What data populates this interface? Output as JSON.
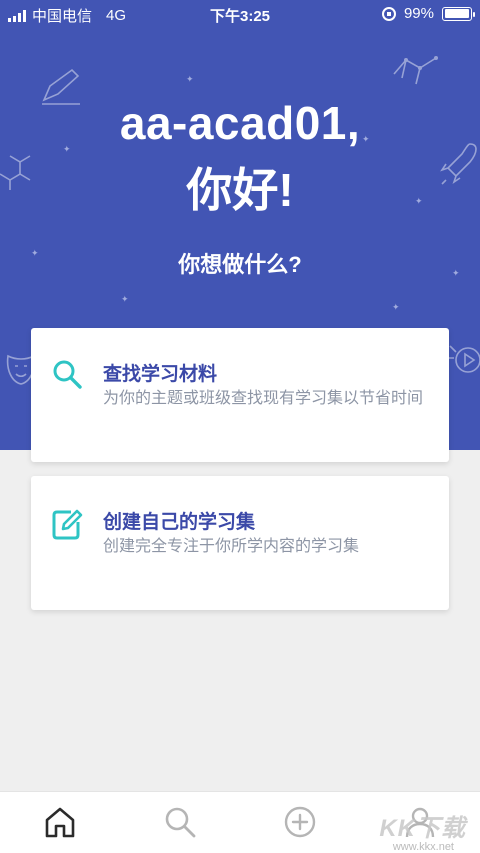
{
  "status_bar": {
    "carrier": "中国电信",
    "network": "4G",
    "time": "下午3:25",
    "battery_percent": "99%",
    "battery_level": 0.99
  },
  "greeting": {
    "username_line": "aa-acad01,",
    "hello_line": "你好!",
    "question": "你想做什么?"
  },
  "cards": {
    "find": {
      "title": "查找学习材料",
      "description": "为你的主题或班级查找现有学习集以节省时间",
      "icon": "search-icon"
    },
    "create": {
      "title": "创建自己的学习集",
      "description": "创建完全专注于你所学内容的学习集",
      "icon": "edit-icon"
    }
  },
  "tabbar": {
    "items": [
      {
        "name": "home",
        "icon": "home-icon",
        "active": true
      },
      {
        "name": "search",
        "icon": "search-icon",
        "active": false
      },
      {
        "name": "create",
        "icon": "plus-circle-icon",
        "active": false
      },
      {
        "name": "profile",
        "icon": "profile-icon",
        "active": false
      }
    ]
  },
  "watermark": {
    "text": "KK下载",
    "url": "www.kkx.net"
  },
  "colors": {
    "hero_blue": "#4255b4",
    "accent_teal": "#2ec4c4",
    "card_title": "#3b49a8",
    "card_desc": "#8d95a5",
    "background": "#efefef"
  }
}
